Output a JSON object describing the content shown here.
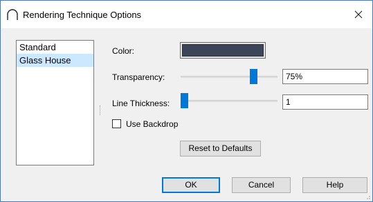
{
  "window": {
    "title": "Rendering Technique Options",
    "close_icon": "close-icon",
    "app_icon": "arc-icon"
  },
  "list": {
    "items": [
      "Standard",
      "Glass House"
    ],
    "selected_index": 1
  },
  "color": {
    "label": "Color:",
    "value": "#3c4658"
  },
  "transparency": {
    "label": "Transparency:",
    "value": "75%",
    "slider_fraction": 0.75
  },
  "line_thickness": {
    "label": "Line Thickness:",
    "value": "1",
    "slider_fraction": 0.0
  },
  "backdrop": {
    "label": "Use Backdrop",
    "checked": false
  },
  "buttons": {
    "reset": "Reset to Defaults",
    "ok": "OK",
    "cancel": "Cancel",
    "help": "Help"
  },
  "colors": {
    "accent": "#0078d7",
    "selection": "#cce8ff"
  }
}
